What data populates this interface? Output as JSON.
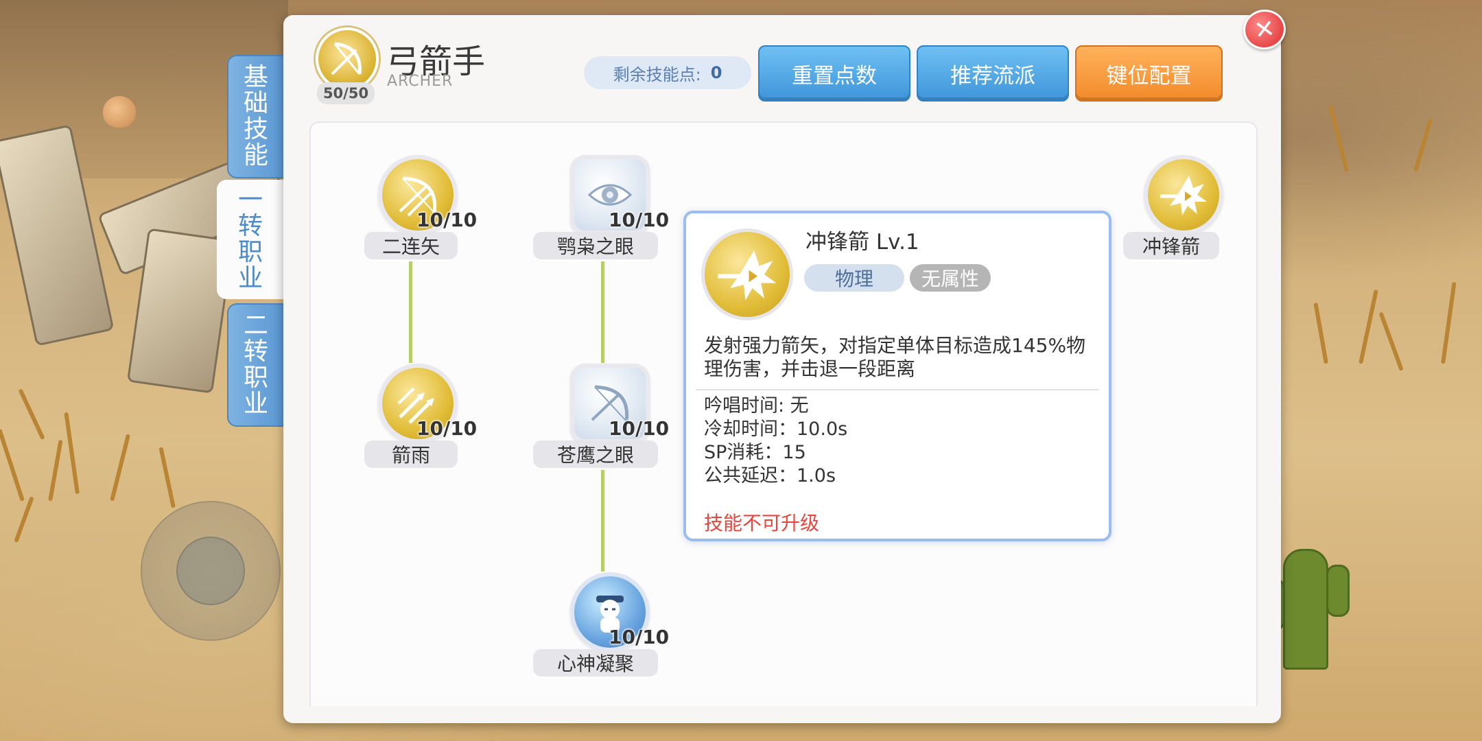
{
  "header": {
    "class_name": "弓箭手",
    "class_subtitle": "ARCHER",
    "class_level": "50/50",
    "remaining_points_label": "剩余技能点:",
    "remaining_points_value": "0"
  },
  "buttons": {
    "reset": "重置点数",
    "recommend": "推荐流派",
    "keybind": "键位配置"
  },
  "tabs": [
    {
      "label_lines": [
        "基",
        "础",
        "技",
        "能"
      ],
      "active": false
    },
    {
      "label_lines": [
        "一",
        "转",
        "职",
        "业"
      ],
      "active": true
    },
    {
      "label_lines": [
        "二",
        "转",
        "职",
        "业"
      ],
      "active": false
    }
  ],
  "skills": [
    {
      "name": "二连矢",
      "level": "10/10",
      "icon": "bow-icon"
    },
    {
      "name": "箭雨",
      "level": "10/10",
      "icon": "arrow-rain-icon"
    },
    {
      "name": "鹗枭之眼",
      "level": "10/10",
      "icon": "eye-icon"
    },
    {
      "name": "苍鹰之眼",
      "level": "10/10",
      "icon": "bow-icon"
    },
    {
      "name": "心神凝聚",
      "level": "10/10",
      "icon": "focus-icon"
    },
    {
      "name": "冲锋箭",
      "level": "",
      "icon": "charge-arrow-icon"
    }
  ],
  "tooltip": {
    "title": "冲锋箭 Lv.1",
    "tag_type": "物理",
    "tag_element": "无属性",
    "description": "发射强力箭矢，对指定单体目标造成145%物理伤害，并击退一段距离",
    "stats": [
      "吟唱时间: 无",
      "冷却时间：10.0s",
      "SP消耗：15",
      "公共延迟：1.0s"
    ],
    "warning": "技能不可升级",
    "icon": "charge-arrow-icon"
  },
  "colors": {
    "accent_blue": "#4a96d8",
    "accent_orange": "#f28a2a",
    "warning_red": "#e8463d",
    "connector_green": "#b5cf6a"
  }
}
